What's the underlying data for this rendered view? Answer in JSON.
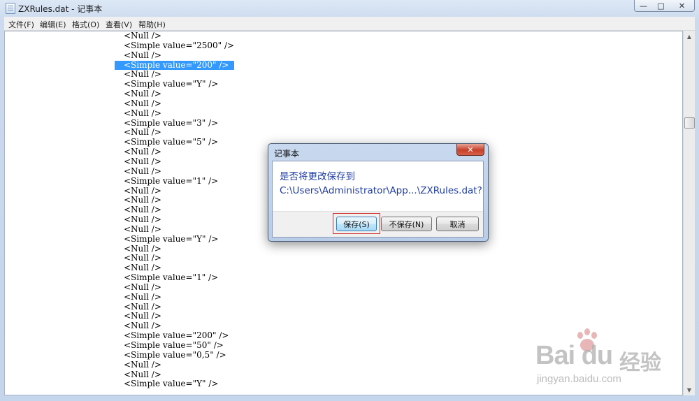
{
  "window": {
    "title": "ZXRules.dat - 记事本",
    "controls": {
      "minimize": "—",
      "maximize": "□",
      "close": "✕"
    }
  },
  "menubar": {
    "items": [
      {
        "label": "文件(F)"
      },
      {
        "label": "编辑(E)"
      },
      {
        "label": "格式(O)"
      },
      {
        "label": "查看(V)"
      },
      {
        "label": "帮助(H)"
      }
    ]
  },
  "editor": {
    "selected_line": 3,
    "lines": [
      "<Null />",
      "<Simple value=\"2500\" />",
      "<Null />",
      "<Simple value=\"200\" />",
      "<Null />",
      "<Simple value=\"Y\" />",
      "<Null />",
      "<Null />",
      "<Null />",
      "<Simple value=\"3\" />",
      "<Null />",
      "<Simple value=\"5\" />",
      "<Null />",
      "<Null />",
      "<Null />",
      "<Simple value=\"1\" />",
      "<Null />",
      "<Null />",
      "<Null />",
      "<Null />",
      "<Null />",
      "<Simple value=\"Y\" />",
      "<Null />",
      "<Null />",
      "<Null />",
      "<Simple value=\"1\" />",
      "<Null />",
      "<Null />",
      "<Null />",
      "<Null />",
      "<Null />",
      "<Simple value=\"200\" />",
      "<Simple value=\"50\" />",
      "<Simple value=\"0,5\" />",
      "<Null />",
      "<Null />",
      "<Simple value=\"Y\" />"
    ]
  },
  "dialog": {
    "title": "记事本",
    "message_line1": "是否将更改保存到",
    "message_line2": "C:\\Users\\Administrator\\App...\\ZXRules.dat?",
    "buttons": {
      "save": "保存(S)",
      "dont_save": "不保存(N)",
      "cancel": "取消"
    },
    "close": "✕"
  },
  "watermark": {
    "brand": "Bai du",
    "brand_cn": "经验",
    "url": "jingyan.baidu.com"
  },
  "scrollbar": {
    "up": "▲",
    "down": "▼"
  }
}
